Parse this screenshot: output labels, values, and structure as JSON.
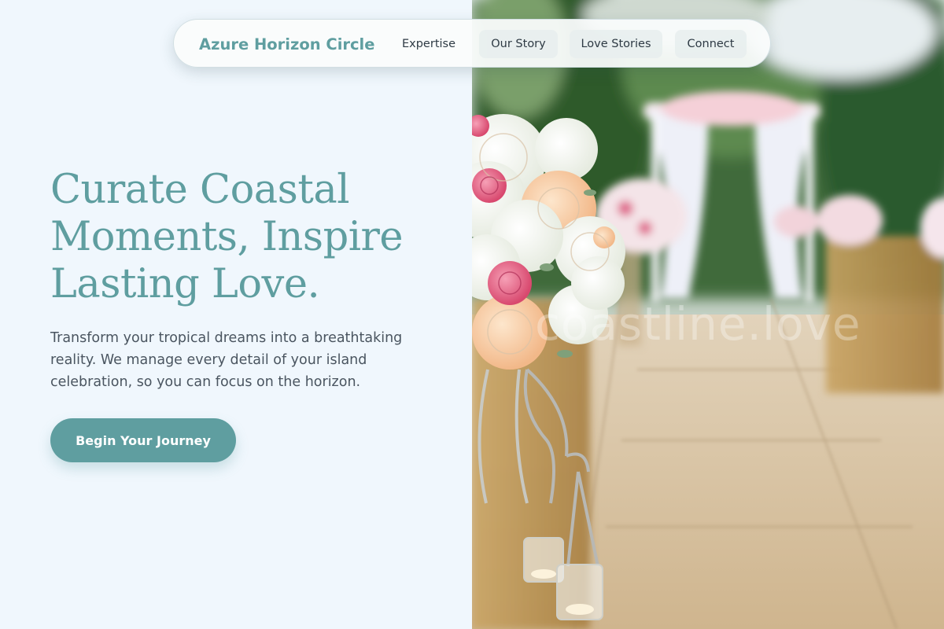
{
  "brand": {
    "name": "Azure Horizon Circle"
  },
  "nav": {
    "items": [
      {
        "label": "Expertise"
      },
      {
        "label": "Our Story"
      },
      {
        "label": "Love Stories"
      },
      {
        "label": "Connect"
      }
    ]
  },
  "hero": {
    "headline_lines": [
      "Curate Coastal",
      "Moments, Inspire",
      "Lasting Love."
    ],
    "subtext_lines": [
      "Transform your tropical dreams into a breathtaking",
      "reality. We manage every detail of your island",
      "celebration, so you can focus on the horizon."
    ],
    "cta_label": "Begin Your Journey"
  },
  "photo": {
    "watermark": "coastline.love"
  },
  "colors": {
    "accent": "#5f9ea0",
    "background": "#f0f7fd",
    "body_text": "#4a5560",
    "nav_text": "#2e3a44"
  }
}
